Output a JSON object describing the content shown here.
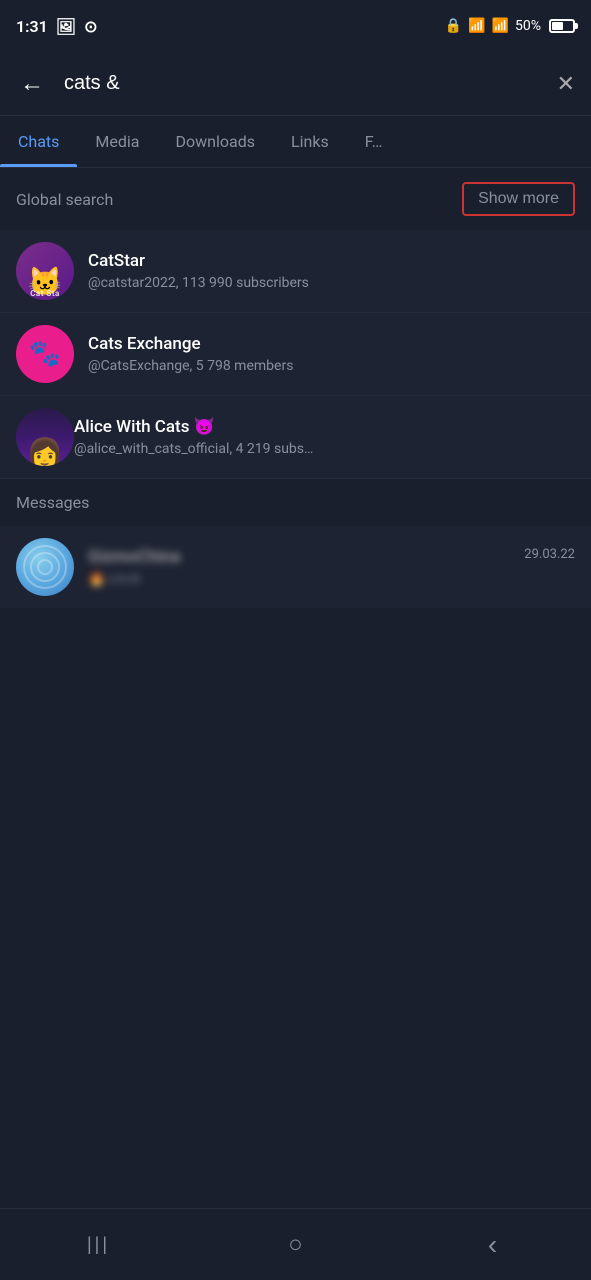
{
  "statusBar": {
    "time": "1:31",
    "battery": "50%",
    "icons": [
      "gallery-icon",
      "whatsapp-icon",
      "lock-icon",
      "wifi-icon",
      "signal-icon"
    ]
  },
  "searchBar": {
    "query": "cats &",
    "backLabel": "←",
    "closeLabel": "✕"
  },
  "tabs": [
    {
      "id": "chats",
      "label": "Chats",
      "active": true
    },
    {
      "id": "media",
      "label": "Media",
      "active": false
    },
    {
      "id": "downloads",
      "label": "Downloads",
      "active": false
    },
    {
      "id": "links",
      "label": "Links",
      "active": false
    },
    {
      "id": "files",
      "label": "F…",
      "active": false
    }
  ],
  "globalSearch": {
    "label": "Global search",
    "showMore": "Show more"
  },
  "results": [
    {
      "id": "catstar",
      "name": "CatStar",
      "handle": "@catstar2022, 113 990 subscribers",
      "avatarType": "catstar"
    },
    {
      "id": "catsexchange",
      "name": "Cats Exchange",
      "handle": "@CatsExchange, 5 798 members",
      "avatarType": "catsexchange"
    },
    {
      "id": "alicewithcats",
      "name": "Alice With Cats 😈",
      "handle": "@alice_with_cats_official, 4 219 subs…",
      "avatarType": "alice"
    }
  ],
  "messagesSection": {
    "label": "Messages",
    "items": [
      {
        "id": "gizmochina",
        "name": "GizmoChina",
        "preview": "🔥cats&",
        "date": "29.03.22",
        "avatarType": "gizmo"
      }
    ]
  },
  "bottomNav": {
    "recent": "|||",
    "home": "○",
    "back": "‹"
  }
}
